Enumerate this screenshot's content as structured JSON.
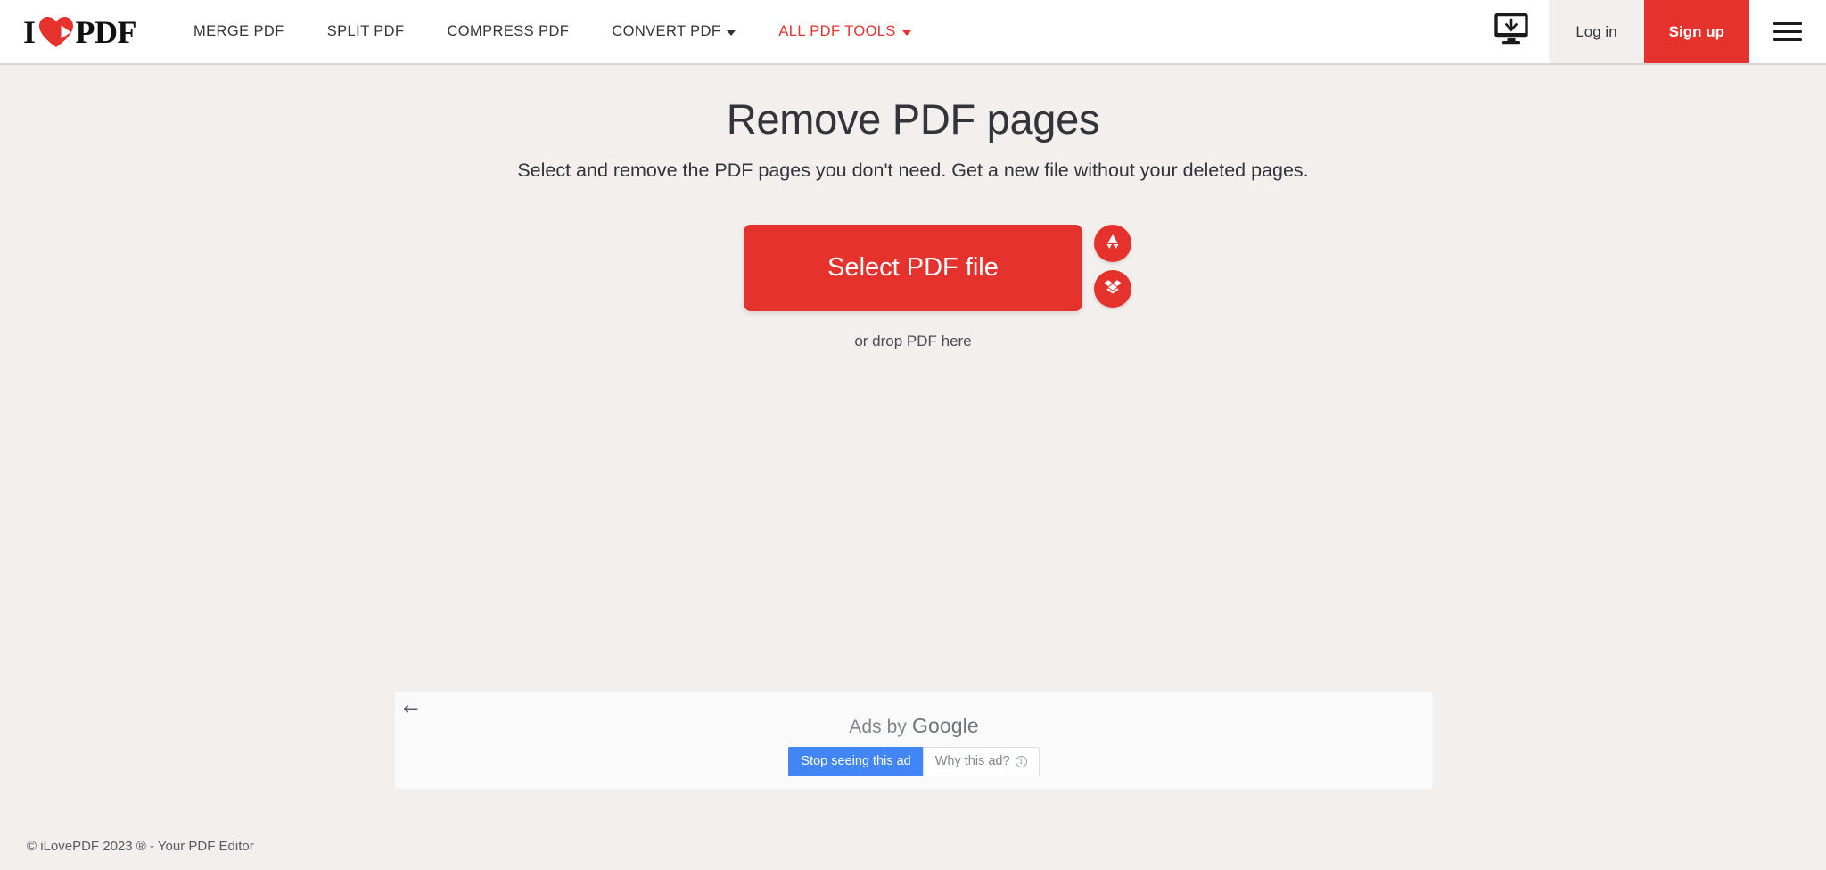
{
  "header": {
    "logo": {
      "text_i": "I",
      "text_pdf": "PDF",
      "heart_icon": "heart-page-icon"
    },
    "nav": [
      {
        "label": "MERGE PDF",
        "accent": false,
        "has_caret": false
      },
      {
        "label": "SPLIT PDF",
        "accent": false,
        "has_caret": false
      },
      {
        "label": "COMPRESS PDF",
        "accent": false,
        "has_caret": false
      },
      {
        "label": "CONVERT PDF",
        "accent": false,
        "has_caret": true
      },
      {
        "label": "ALL PDF TOOLS",
        "accent": true,
        "has_caret": true
      }
    ],
    "desktop_icon": "desktop-download-icon",
    "login_label": "Log in",
    "signup_label": "Sign up",
    "menu_icon": "hamburger-menu-icon"
  },
  "main": {
    "title": "Remove PDF pages",
    "subtitle": "Select and remove the PDF pages you don't need. Get a new file without your deleted pages.",
    "select_button_label": "Select PDF file",
    "drop_hint": "or drop PDF here",
    "cloud_buttons": [
      {
        "name": "google-drive-icon"
      },
      {
        "name": "dropbox-icon"
      }
    ]
  },
  "ad": {
    "back_glyph": "←",
    "ads_by_prefix": "Ads by ",
    "ads_by_brand": "Google",
    "stop_label": "Stop seeing this ad",
    "why_label": "Why this ad?",
    "info_glyph": "i"
  },
  "footer": {
    "copyright": "© iLovePDF 2023 ® - Your PDF Editor"
  },
  "colors": {
    "brand_red": "#e5322d",
    "page_bg": "#f2efec",
    "header_bg": "#ffffff",
    "text": "#33333b",
    "google_blue": "#4285f4"
  }
}
